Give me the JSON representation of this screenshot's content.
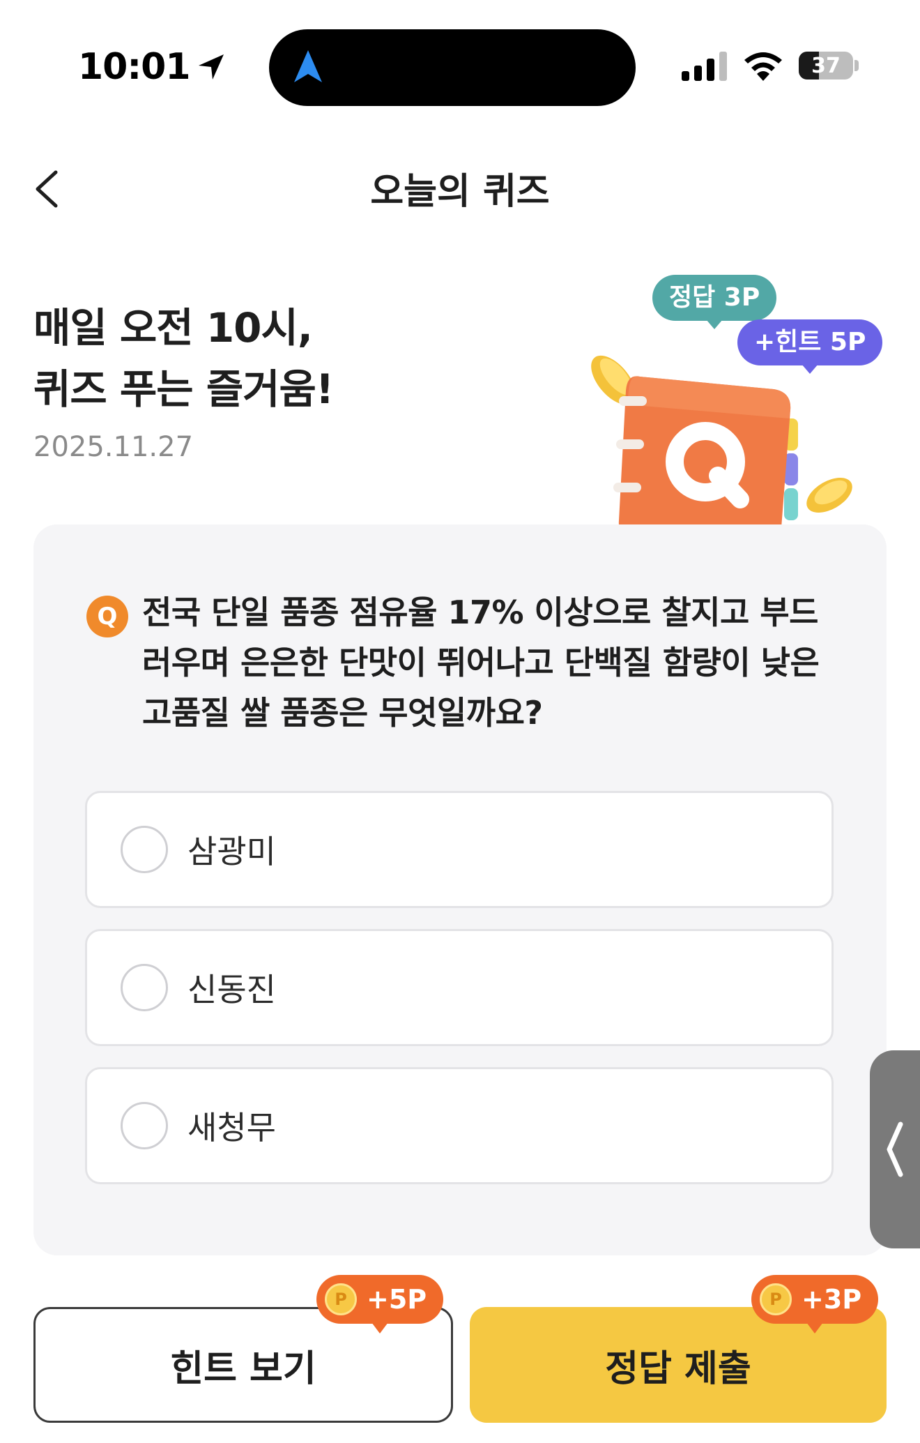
{
  "status_bar": {
    "time": "10:01",
    "battery": "37"
  },
  "header": {
    "title": "오늘의 퀴즈"
  },
  "hero": {
    "title_line1": "매일 오전 10시,",
    "title_line2": "퀴즈 푸는 즐거움!",
    "date": "2025.11.27",
    "badge_correct": "정답 3P",
    "badge_hint": "+힌트 5P"
  },
  "quiz": {
    "badge": "Q",
    "question": "전국 단일 품종 점유율 17% 이상으로 찰지고 부드러우며 은은한 단맛이 뛰어나고 단백질 함량이 낮은 고품질 쌀 품종은 무엇일까요?",
    "question_lines": [
      "전국 단일 품종 점유율 17% 이상으로 찰지고 부드",
      "러우며 은은한 단맛이 뛰어나고 단백질 함량이 낮은",
      "고품질 쌀 품종은 무엇일까요?"
    ],
    "options": [
      {
        "label": "삼광미",
        "selected": false
      },
      {
        "label": "신동진",
        "selected": false
      },
      {
        "label": "새청무",
        "selected": false
      }
    ]
  },
  "actions": {
    "hint_label": "힌트 보기",
    "hint_reward": "+5P",
    "submit_label": "정답 제출",
    "submit_reward": "+3P",
    "coin_letter": "P"
  },
  "colors": {
    "accent_yellow": "#f5c842",
    "accent_orange": "#f06a2a",
    "badge_teal": "#52a8a6",
    "badge_purple": "#6a63e6"
  }
}
